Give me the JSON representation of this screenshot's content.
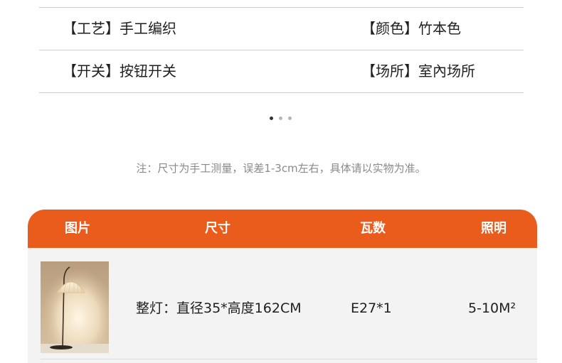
{
  "specs": [
    {
      "left_label": "【工艺】",
      "left_value": "手工编织",
      "right_label": "【颜色】",
      "right_value": "竹本色"
    },
    {
      "left_label": "【开关】",
      "left_value": "按钮开关",
      "right_label": "【场所】",
      "right_value": "室內场所"
    }
  ],
  "carousel": {
    "active_index": 0,
    "count": 3
  },
  "note": "注：尺寸为手工测量，误差1-3cm左右，具体请以实物为准。",
  "table": {
    "headers": [
      "图片",
      "尺寸",
      "瓦数",
      "照明"
    ],
    "rows": [
      {
        "image_icon": "floor-lamp-photo",
        "size": "整灯：直径35*高度162CM",
        "wattage": "E27*1",
        "lighting": "5-10M²"
      }
    ]
  },
  "colors": {
    "accent": "#e95c1c",
    "row_bg": "#f3f3f3",
    "divider": "#cfcfcf",
    "note_text": "#8a8a8a"
  }
}
